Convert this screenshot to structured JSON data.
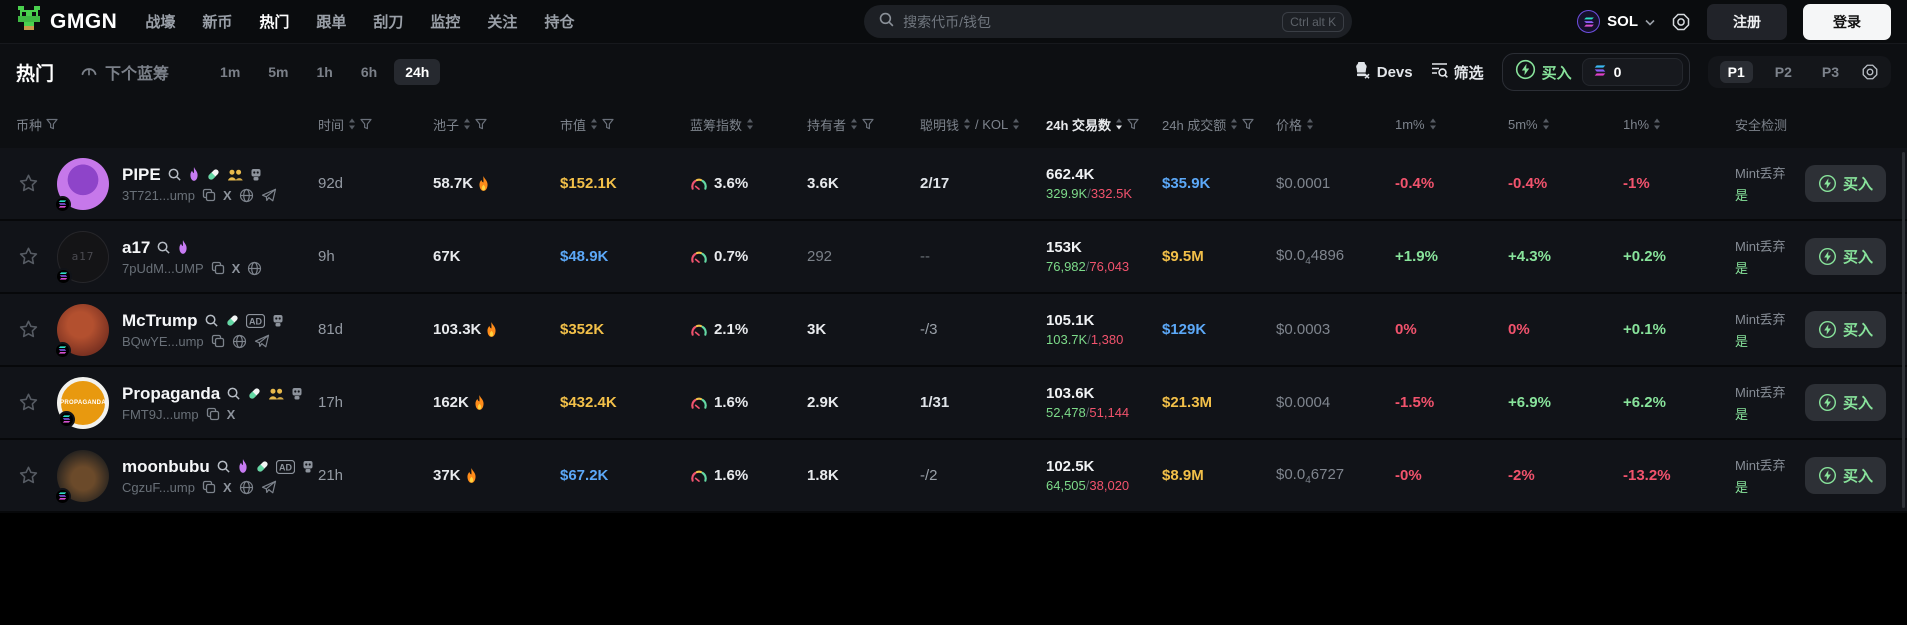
{
  "navbar": {
    "brand": "GMGN",
    "items": [
      "战壕",
      "新币",
      "热门",
      "跟单",
      "刮刀",
      "监控",
      "关注",
      "持仓"
    ],
    "active_item": "热门",
    "search": {
      "placeholder": "搜索代币/钱包",
      "shortcut": "Ctrl alt K"
    },
    "chain": {
      "label": "SOL"
    },
    "signup_label": "注册",
    "login_label": "登录"
  },
  "toolbar": {
    "title": "热门",
    "next_bluechip": "下个蓝筹",
    "timeframes": [
      "1m",
      "5m",
      "1h",
      "6h",
      "24h"
    ],
    "active_timeframe": "24h",
    "devs_label": "Devs",
    "filter_label": "筛选",
    "buy_label": "买入",
    "buy_amount": "0",
    "presets": [
      "P1",
      "P2",
      "P3"
    ],
    "active_preset": "P1"
  },
  "table": {
    "buy_label": "买入",
    "columns": [
      {
        "key": "token",
        "label": "币种",
        "funnel": true
      },
      {
        "key": "age",
        "label": "时间",
        "sort": true,
        "funnel": true
      },
      {
        "key": "pool",
        "label": "池子",
        "sort": true,
        "funnel": true
      },
      {
        "key": "mcap",
        "label": "市值",
        "sort": true,
        "funnel": true
      },
      {
        "key": "bluechip",
        "label": "蓝筹指数",
        "sort": true
      },
      {
        "key": "holders",
        "label": "持有者",
        "sort": true,
        "funnel": true
      },
      {
        "key": "smart",
        "label": "聪明钱",
        "sort": true,
        "label2": "/ KOL",
        "sort2": true
      },
      {
        "key": "txs",
        "label": "24h 交易数",
        "sort": true,
        "funnel": true,
        "active": true
      },
      {
        "key": "volume",
        "label": "24h 成交额",
        "sort": true,
        "funnel": true
      },
      {
        "key": "price",
        "label": "价格",
        "sort": true
      },
      {
        "key": "chg-1m",
        "label": "1m%",
        "sort": true
      },
      {
        "key": "chg-5m",
        "label": "5m%",
        "sort": true
      },
      {
        "key": "chg-1h",
        "label": "1h%",
        "sort": true
      },
      {
        "key": "security",
        "label": "安全检测"
      },
      {
        "key": "action",
        "label": ""
      }
    ],
    "rows": [
      {
        "name": "PIPE",
        "avatar": "pipe",
        "avatar_text": "",
        "address": "3T721...ump",
        "badges": [
          "flame",
          "pill",
          "people",
          "robot"
        ],
        "links": [
          "copy",
          "x",
          "globe",
          "telegram"
        ],
        "age": "92d",
        "pool": "58.7K",
        "fire": true,
        "mcap": "$152.1K",
        "mcap_color": "yellow",
        "bluechip": "3.6%",
        "holders": "3.6K",
        "holders_dim": false,
        "smart": "2/17",
        "smart_tone": "bright",
        "txs": "662.4K",
        "buys": "329.9K",
        "sells": "332.5K",
        "volume": "$35.9K",
        "volume_color": "blue",
        "price": [
          "$0.0001"
        ],
        "changes": [
          {
            "v": "-0.4%",
            "dir": "down"
          },
          {
            "v": "-0.4%",
            "dir": "down"
          },
          {
            "v": "-1%",
            "dir": "down"
          }
        ],
        "security_label": "Mint丢弃",
        "security_value": "是"
      },
      {
        "name": "a17",
        "avatar": "a17",
        "avatar_text": "a17",
        "address": "7pUdM...UMP",
        "badges": [
          "flame"
        ],
        "links": [
          "copy",
          "x",
          "globe"
        ],
        "age": "9h",
        "pool": "67K",
        "fire": false,
        "mcap": "$48.9K",
        "mcap_color": "blue",
        "bluechip": "0.7%",
        "holders": "292",
        "holders_dim": true,
        "smart": "--",
        "smart_tone": "dim",
        "txs": "153K",
        "buys": "76,982",
        "sells": "76,043",
        "volume": "$9.5M",
        "volume_color": "yellow",
        "price": [
          "$0.0",
          "4",
          "4896"
        ],
        "changes": [
          {
            "v": "+1.9%",
            "dir": "up"
          },
          {
            "v": "+4.3%",
            "dir": "up"
          },
          {
            "v": "+0.2%",
            "dir": "up"
          }
        ],
        "security_label": "Mint丢弃",
        "security_value": "是"
      },
      {
        "name": "McTrump",
        "avatar": "mctrump",
        "avatar_text": "",
        "address": "BQwYE...ump",
        "badges": [
          "pill",
          "ad",
          "robot"
        ],
        "links": [
          "copy",
          "globe",
          "telegram"
        ],
        "age": "81d",
        "pool": "103.3K",
        "fire": true,
        "mcap": "$352K",
        "mcap_color": "yellow",
        "bluechip": "2.1%",
        "holders": "3K",
        "holders_dim": false,
        "smart": "-/3",
        "smart_tone": "mid",
        "txs": "105.1K",
        "buys": "103.7K",
        "sells": "1,380",
        "volume": "$129K",
        "volume_color": "blue",
        "price": [
          "$0.0003"
        ],
        "changes": [
          {
            "v": "0%",
            "dir": "down"
          },
          {
            "v": "0%",
            "dir": "down"
          },
          {
            "v": "+0.1%",
            "dir": "up"
          }
        ],
        "security_label": "Mint丢弃",
        "security_value": "是"
      },
      {
        "name": "Propaganda",
        "avatar": "propaganda",
        "avatar_text": "PROPAGANDA",
        "address": "FMT9J...ump",
        "badges": [
          "pill",
          "people",
          "robot"
        ],
        "links": [
          "copy",
          "x"
        ],
        "age": "17h",
        "pool": "162K",
        "fire": true,
        "mcap": "$432.4K",
        "mcap_color": "yellow",
        "bluechip": "1.6%",
        "holders": "2.9K",
        "holders_dim": false,
        "smart": "1/31",
        "smart_tone": "bright",
        "txs": "103.6K",
        "buys": "52,478",
        "sells": "51,144",
        "volume": "$21.3M",
        "volume_color": "yellow",
        "price": [
          "$0.0004"
        ],
        "changes": [
          {
            "v": "-1.5%",
            "dir": "down"
          },
          {
            "v": "+6.9%",
            "dir": "up"
          },
          {
            "v": "+6.2%",
            "dir": "up"
          }
        ],
        "security_label": "Mint丢弃",
        "security_value": "是"
      },
      {
        "name": "moonbubu",
        "avatar": "moonbubu",
        "avatar_text": "",
        "address": "CgzuF...ump",
        "badges": [
          "flame",
          "pill",
          "ad",
          "robot"
        ],
        "links": [
          "copy",
          "x",
          "globe",
          "telegram"
        ],
        "age": "21h",
        "pool": "37K",
        "fire": true,
        "mcap": "$67.2K",
        "mcap_color": "blue",
        "bluechip": "1.6%",
        "holders": "1.8K",
        "holders_dim": false,
        "smart": "-/2",
        "smart_tone": "mid",
        "txs": "102.5K",
        "buys": "64,505",
        "sells": "38,020",
        "volume": "$8.9M",
        "volume_color": "yellow",
        "price": [
          "$0.0",
          "4",
          "6727"
        ],
        "changes": [
          {
            "v": "-0%",
            "dir": "down"
          },
          {
            "v": "-2%",
            "dir": "down"
          },
          {
            "v": "-13.2%",
            "dir": "down"
          }
        ],
        "security_label": "Mint丢弃",
        "security_value": "是"
      }
    ]
  },
  "colors": {
    "up_green": "#88e39b",
    "down_pink": "#f2536d",
    "mcap_yellow": "#f3c049",
    "value_blue": "#5ca8f7",
    "buy_green": "#88e39b",
    "purple_flame": "#c77bf3"
  }
}
